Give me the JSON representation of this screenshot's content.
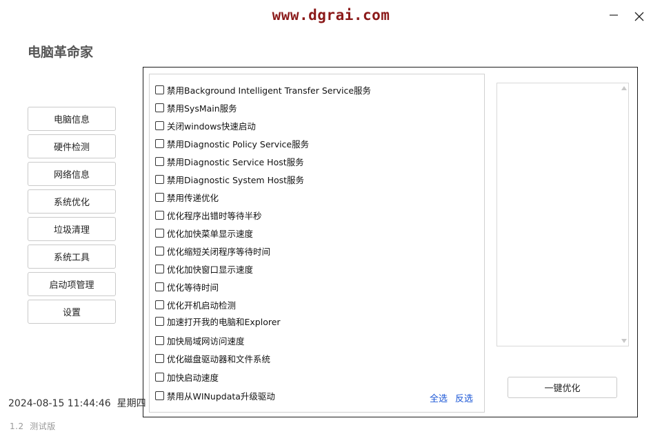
{
  "watermark": "www.dgrai.com",
  "window": {
    "minimize_icon": "minimize-icon",
    "close_icon": "close-icon"
  },
  "app_title": "电脑革命家",
  "nav": {
    "items": [
      {
        "label": "电脑信息"
      },
      {
        "label": "硬件检测"
      },
      {
        "label": "网络信息"
      },
      {
        "label": "系统优化"
      },
      {
        "label": "垃圾清理"
      },
      {
        "label": "系统工具"
      },
      {
        "label": "启动项管理"
      },
      {
        "label": "设置"
      }
    ]
  },
  "status": {
    "datetime": "2024-08-15 11:44:46  星期四",
    "version": "1.2  测试版"
  },
  "options": [
    {
      "label": "禁用Background Intelligent Transfer Service服务",
      "checked": false
    },
    {
      "label": "禁用SysMain服务",
      "checked": false
    },
    {
      "label": "关闭windows快速启动",
      "checked": false
    },
    {
      "label": "禁用Diagnostic Policy Service服务",
      "checked": false
    },
    {
      "label": "禁用Diagnostic Service Host服务",
      "checked": false
    },
    {
      "label": "禁用Diagnostic System Host服务",
      "checked": false
    },
    {
      "label": "禁用传递优化",
      "checked": false
    },
    {
      "label": "优化程序出错时等待半秒",
      "checked": false
    },
    {
      "label": "优化加快菜单显示速度",
      "checked": false
    },
    {
      "label": "优化缩短关闭程序等待时间",
      "checked": false
    },
    {
      "label": "优化加快窗口显示速度",
      "checked": false
    },
    {
      "label": "优化等待时间",
      "checked": false
    },
    {
      "label": "优化开机启动检测",
      "checked": false
    },
    {
      "label": "加速打开我的电脑和Explorer",
      "checked": false
    },
    {
      "label": "加快局域网访问速度",
      "checked": false
    },
    {
      "label": "优化磁盘驱动器和文件系统",
      "checked": false
    },
    {
      "label": "加快启动速度",
      "checked": false
    },
    {
      "label": "禁用从WINupdata升级驱动",
      "checked": false
    }
  ],
  "select_all_label": "全选",
  "invert_label": "反选",
  "optimize_button_label": "一键优化",
  "colors": {
    "watermark": "#8b1a1a",
    "link": "#1a56d6"
  }
}
